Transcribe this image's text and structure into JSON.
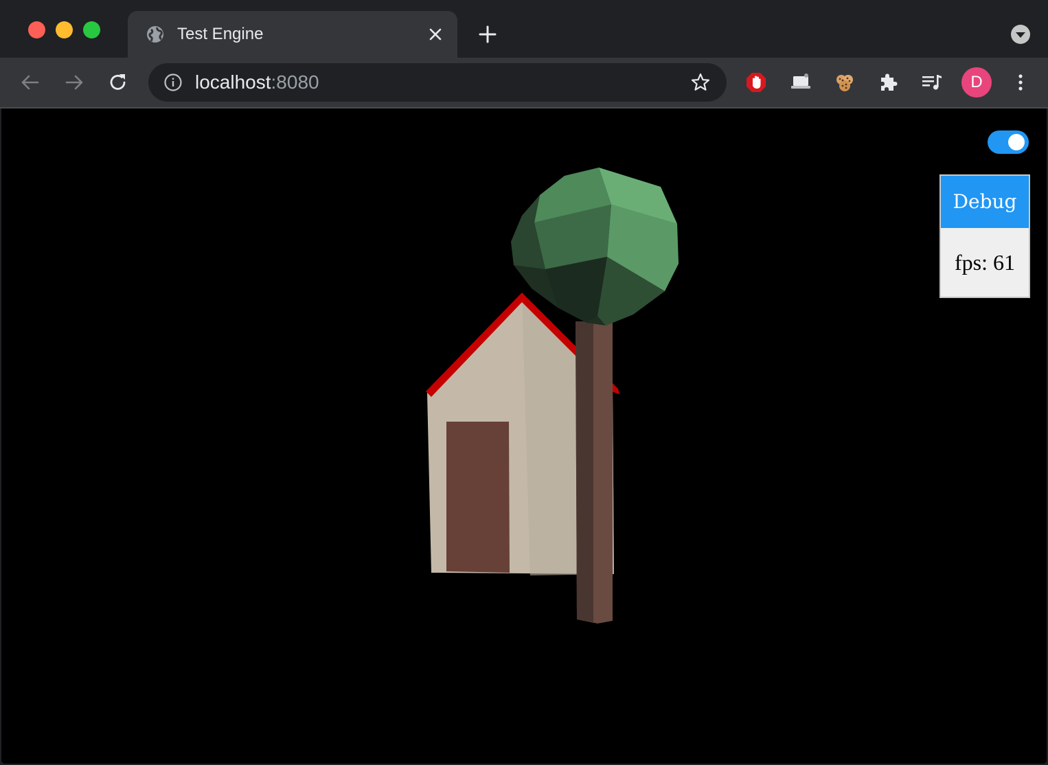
{
  "browser": {
    "tab": {
      "title": "Test Engine",
      "favicon": "globe-icon",
      "close": "close-icon"
    },
    "new_tab": "plus-icon",
    "tab_search": "chevron-down-circle-icon",
    "toolbar": {
      "back": "arrow-left-icon",
      "forward": "arrow-right-icon",
      "reload": "reload-icon",
      "url_host": "localhost",
      "url_port": ":8080",
      "site_info": "info-icon",
      "bookmark": "star-icon",
      "extensions": [
        "stop-hand-icon",
        "laptop-icon",
        "cookie-icon",
        "puzzle-icon",
        "playlist-icon"
      ],
      "profile_initial": "D",
      "menu": "kebab-menu-icon"
    },
    "colors": {
      "frame": "#202124",
      "toolbar": "#35363a",
      "avatar": "#e8457c"
    }
  },
  "app": {
    "toggle": {
      "on": true,
      "color": "#2196f3"
    },
    "debug": {
      "title": "Debug",
      "fps": "fps: 61"
    },
    "scene": {
      "objects": [
        "house",
        "tree"
      ],
      "background": "#000000"
    }
  }
}
